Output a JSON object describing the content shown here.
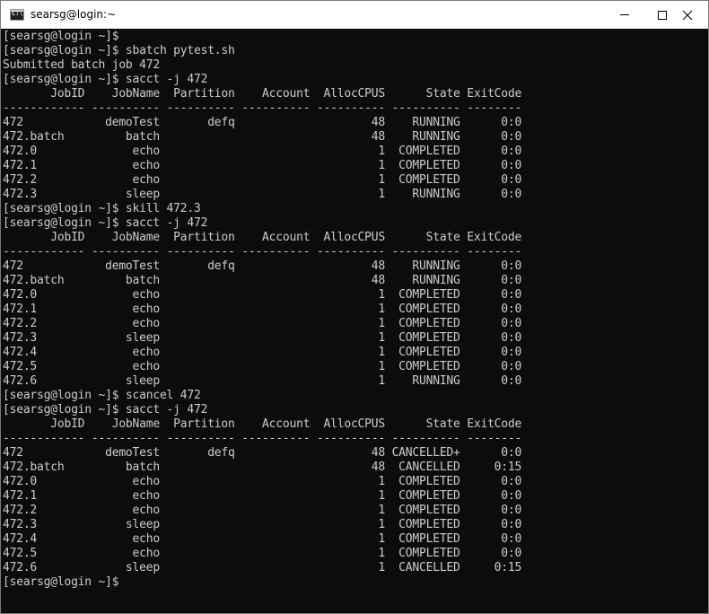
{
  "window": {
    "title": "searsg@login:~",
    "icon_label": "C:\\.",
    "icon": "console-app-icon",
    "controls": [
      "minimize-icon",
      "maximize-icon",
      "close-icon"
    ]
  },
  "colors": {
    "console_background": "#0c0c0c",
    "console_text": "#cccccc",
    "titlebar_background": "#ffffff"
  },
  "console": {
    "lines": [
      "[searsg@login ~]$",
      "[searsg@login ~]$ sbatch pytest.sh",
      "Submitted batch job 472",
      "[searsg@login ~]$ sacct -j 472",
      "       JobID    JobName  Partition    Account  AllocCPUS      State ExitCode",
      "------------ ---------- ---------- ---------- ---------- ---------- --------",
      "472            demoTest       defq                    48    RUNNING      0:0",
      "472.batch         batch                               48    RUNNING      0:0",
      "472.0              echo                                1  COMPLETED      0:0",
      "472.1              echo                                1  COMPLETED      0:0",
      "472.2              echo                                1  COMPLETED      0:0",
      "472.3             sleep                                1    RUNNING      0:0",
      "[searsg@login ~]$ skill 472.3",
      "[searsg@login ~]$ sacct -j 472",
      "       JobID    JobName  Partition    Account  AllocCPUS      State ExitCode",
      "------------ ---------- ---------- ---------- ---------- ---------- --------",
      "472            demoTest       defq                    48    RUNNING      0:0",
      "472.batch         batch                               48    RUNNING      0:0",
      "472.0              echo                                1  COMPLETED      0:0",
      "472.1              echo                                1  COMPLETED      0:0",
      "472.2              echo                                1  COMPLETED      0:0",
      "472.3             sleep                                1  COMPLETED      0:0",
      "472.4              echo                                1  COMPLETED      0:0",
      "472.5              echo                                1  COMPLETED      0:0",
      "472.6             sleep                                1    RUNNING      0:0",
      "[searsg@login ~]$ scancel 472",
      "[searsg@login ~]$ sacct -j 472",
      "       JobID    JobName  Partition    Account  AllocCPUS      State ExitCode",
      "------------ ---------- ---------- ---------- ---------- ---------- --------",
      "472            demoTest       defq                    48 CANCELLED+      0:0",
      "472.batch         batch                               48  CANCELLED     0:15",
      "472.0              echo                                1  COMPLETED      0:0",
      "472.1              echo                                1  COMPLETED      0:0",
      "472.2              echo                                1  COMPLETED      0:0",
      "472.3             sleep                                1  COMPLETED      0:0",
      "472.4              echo                                1  COMPLETED      0:0",
      "472.5              echo                                1  COMPLETED      0:0",
      "472.6             sleep                                1  CANCELLED     0:15",
      "[searsg@login ~]$"
    ]
  }
}
